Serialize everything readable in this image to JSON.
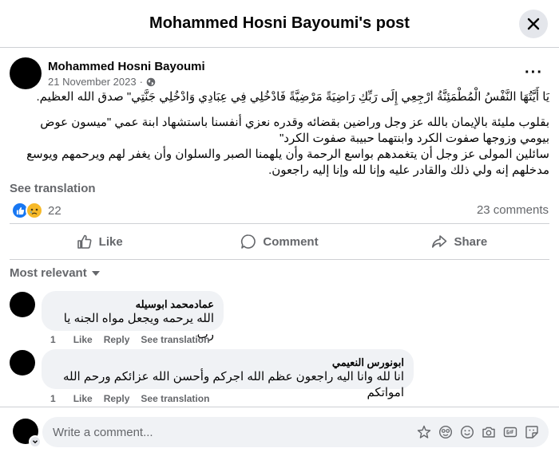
{
  "header": {
    "title": "Mohammed Hosni Bayoumi's post"
  },
  "post": {
    "author": "Mohammed Hosni Bayoumi",
    "date": "21 November 2023",
    "meta_separator": "·",
    "privacy_icon": "globe-icon",
    "more": "···",
    "paragraphs": [
      "يَا أَيَّتُهَا النَّفْسُ الْمُطْمَئِنَّةُ ارْجِعِي إِلَى رَبِّكِ رَاضِيَةً مَرْضِيَّةً فَادْخُلِي فِي عِبَادِي وَادْخُلِي جَنَّتِي\" صدق الله العظيم.",
      "بقلوب مليئة بالإيمان بالله عز وجل وراضين بقضائه وقدره نعزي أنفسنا باستشهاد ابنة عمي \"ميسون عوض بيومي وزوجها صفوت الكرد وابنتهما حبيبة صفوت الكرد\"\nسائلين المولى عز وجل أن يتغمدهم بواسع الرحمة وأن يلهمنا الصبر والسلوان وأن يغفر لهم ويرحمهم ويوسع مدخلهم  إنه ولي ذلك والقادر عليه وإنا لله وإنا إليه راجعون."
    ],
    "see_translation": "See translation",
    "reaction_count": "22",
    "comments_count": "23 comments"
  },
  "actions": {
    "like": "Like",
    "comment": "Comment",
    "share": "Share"
  },
  "sort": {
    "label": "Most relevant"
  },
  "comments": [
    {
      "author": "عمادمحمد ابوسيله",
      "text": "الله يرحمه ويجعل مواه الجنه يا رب",
      "count": "1",
      "like": "Like",
      "reply": "Reply",
      "see_translation": "See translation"
    },
    {
      "author": "ابونورس النعيمي",
      "text": "انا لله وانا اليه راجعون عظم الله اجركم وأحسن الله عزائكم ورحم الله امواتكم",
      "count": "1",
      "like": "Like",
      "reply": "Reply",
      "see_translation": "See translation"
    }
  ],
  "composer": {
    "placeholder": "Write a comment...",
    "icons": [
      "avatar-sticker-icon",
      "emoji-smile-icon",
      "smiley-icon",
      "camera-icon",
      "gif-icon",
      "sticker-icon"
    ]
  },
  "colors": {
    "accent": "#1877f2",
    "secondary_text": "#65676b",
    "bubble": "#f0f2f5",
    "divider": "#ced0d4"
  }
}
